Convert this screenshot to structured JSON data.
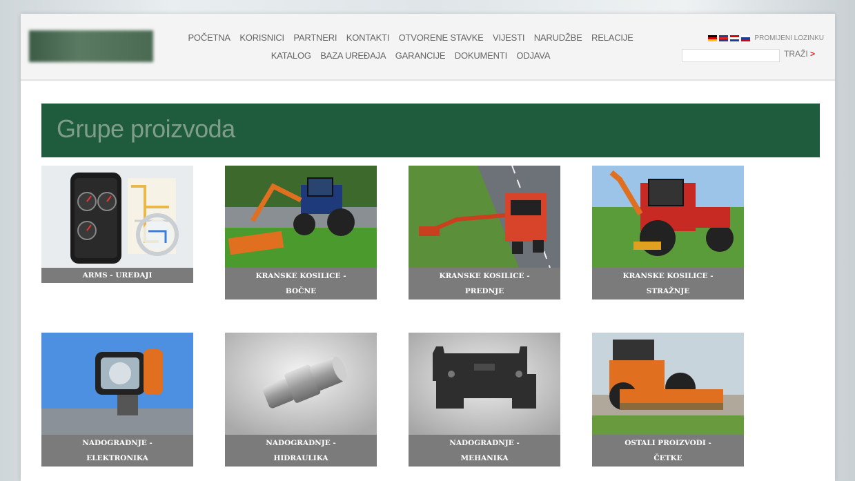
{
  "nav": {
    "items": [
      "POČETNA",
      "KORISNICI",
      "PARTNERI",
      "KONTAKTI",
      "OTVORENE STAVKE",
      "VIJESTI",
      "NARUDŽBE",
      "RELACIJE",
      "KATALOG",
      "BAZA UREĐAJA",
      "GARANCIJE",
      "DOKUMENTI",
      "ODJAVA"
    ]
  },
  "header": {
    "change_password": "PROMIJENI LOZINKU",
    "search_label": "TRAŽI",
    "search_arrow": ">"
  },
  "page": {
    "title": "Grupe proizvoda"
  },
  "products": [
    {
      "lines": [
        "ARMS - UREĐAJI"
      ]
    },
    {
      "lines": [
        "KRANSKE KOSILICE -",
        "BOČNE"
      ]
    },
    {
      "lines": [
        "KRANSKE KOSILICE -",
        "PREDNJE"
      ]
    },
    {
      "lines": [
        "KRANSKE KOSILICE -",
        "STRAŽNJE"
      ]
    },
    {
      "lines": [
        "NADOGRADNJE -",
        "ELEKTRONIKA"
      ]
    },
    {
      "lines": [
        "NADOGRADNJE -",
        "HIDRAULIKA"
      ]
    },
    {
      "lines": [
        "NADOGRADNJE -",
        "MEHANIKA"
      ]
    },
    {
      "lines": [
        "OSTALI PROIZVODI -",
        "ČETKE"
      ]
    }
  ],
  "colors": {
    "brand_green": "#1f5c3e",
    "label_gray": "#7b7b7b",
    "accent_red": "#d22222"
  }
}
